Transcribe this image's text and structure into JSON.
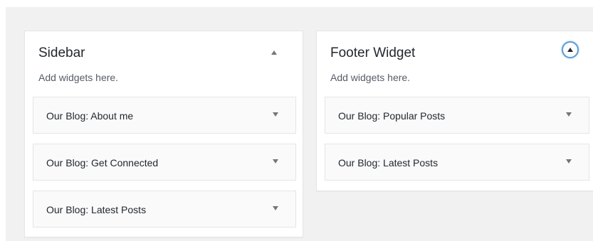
{
  "areas": [
    {
      "title": "Sidebar",
      "description": "Add widgets here.",
      "toggle_icon": "collapse-arrow-up-icon",
      "widgets": [
        {
          "title": "Our Blog: About me"
        },
        {
          "title": "Our Blog: Get Connected"
        },
        {
          "title": "Our Blog: Latest Posts"
        }
      ]
    },
    {
      "title": "Footer Widget",
      "description": "Add widgets here.",
      "toggle_icon": "collapse-arrow-up-circle-icon",
      "widgets": [
        {
          "title": "Our Blog: Popular Posts"
        },
        {
          "title": "Our Blog: Latest Posts"
        }
      ]
    }
  ],
  "colors": {
    "background": "#f1f1f1",
    "focus_ring": "#5b9dd9",
    "text": "#23282d",
    "muted_text": "#555d66"
  }
}
